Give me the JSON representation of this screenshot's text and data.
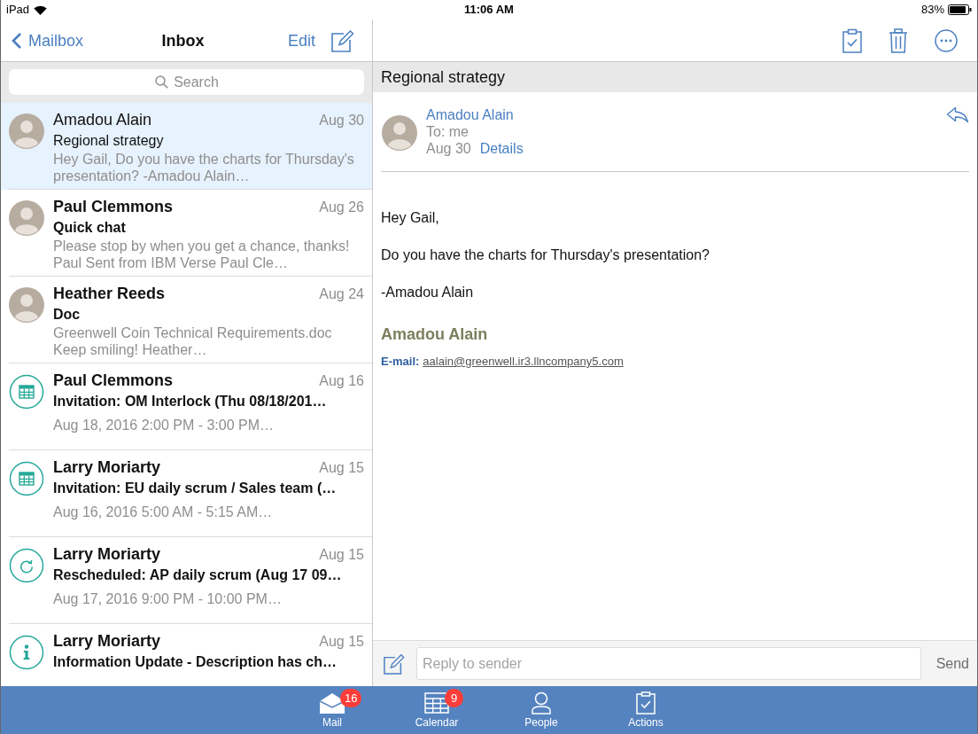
{
  "status_bar": {
    "device": "iPad",
    "time": "11:06 AM",
    "battery": "83%"
  },
  "list_nav": {
    "back": "Mailbox",
    "title": "Inbox",
    "edit": "Edit"
  },
  "search": {
    "placeholder": "Search"
  },
  "messages": [
    {
      "kind": "person",
      "sender": "Amadou Alain",
      "date": "Aug 30",
      "subject": "Regional strategy",
      "preview": "Hey Gail, Do you have the charts for Thursday's presentation? -Amadou Alain…",
      "selected": true,
      "unread": false
    },
    {
      "kind": "person",
      "sender": "Paul Clemmons",
      "date": "Aug 26",
      "subject": "Quick chat",
      "preview": "Please stop by when you get a chance, thanks! Paul Sent from IBM Verse Paul Cle…",
      "selected": false,
      "unread": true
    },
    {
      "kind": "person",
      "sender": "Heather Reeds",
      "date": "Aug 24",
      "subject": "Doc",
      "preview": "Greenwell Coin Technical Requirements.doc Keep smiling! Heather…",
      "selected": false,
      "unread": true
    },
    {
      "kind": "calendar",
      "sender": "Paul Clemmons",
      "date": "Aug 16",
      "subject": "Invitation: OM Interlock (Thu 08/18/201…",
      "preview": "Aug 18, 2016 2:00 PM - 3:00 PM…",
      "selected": false,
      "unread": true
    },
    {
      "kind": "calendar",
      "sender": "Larry Moriarty",
      "date": "Aug 15",
      "subject": "Invitation: EU daily scrum / Sales team (…",
      "preview": "Aug 16, 2016 5:00 AM - 5:15 AM…",
      "selected": false,
      "unread": true
    },
    {
      "kind": "rescheduled",
      "sender": "Larry Moriarty",
      "date": "Aug 15",
      "subject": "Rescheduled: AP daily scrum (Aug 17 09…",
      "preview": "Aug 17, 2016 9:00 PM - 10:00 PM…",
      "selected": false,
      "unread": true
    },
    {
      "kind": "info",
      "sender": "Larry Moriarty",
      "date": "Aug 15",
      "subject": "Information Update - Description has ch…",
      "selected": false,
      "unread": true
    }
  ],
  "reader": {
    "subject": "Regional strategy",
    "sender": "Amadou Alain",
    "to": "To: me",
    "date": "Aug 30",
    "details": "Details",
    "body": [
      "Hey Gail,",
      "Do you have the charts for Thursday's presentation?",
      "-Amadou Alain"
    ],
    "signature": {
      "name": "Amadou Alain",
      "email_label": "E-mail:",
      "email": "aalain@greenwell.ir3.llncompany5.com"
    }
  },
  "reply": {
    "placeholder": "Reply to sender",
    "send": "Send"
  },
  "tabs": [
    {
      "kind": "mail",
      "label": "Mail",
      "badge": "16"
    },
    {
      "kind": "calendar",
      "label": "Calendar",
      "badge": "9"
    },
    {
      "kind": "people",
      "label": "People"
    },
    {
      "kind": "actions",
      "label": "Actions"
    }
  ]
}
